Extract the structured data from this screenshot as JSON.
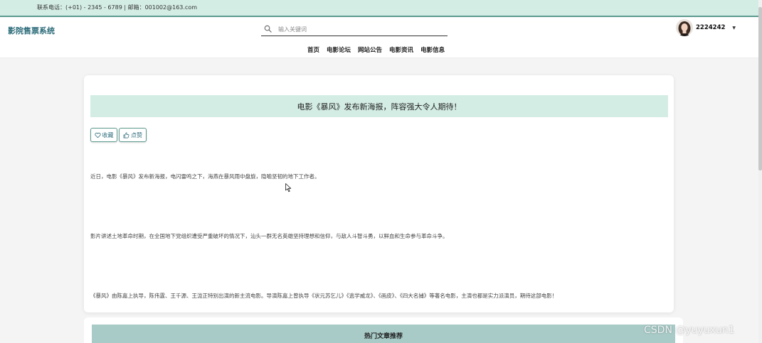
{
  "topbar": {
    "contact": "联系电话：(+01) - 2345 - 6789 | 邮箱：001002@163.com"
  },
  "header": {
    "brand": "影院售票系统",
    "search_placeholder": "输入关键词",
    "nav": [
      {
        "label": "首页"
      },
      {
        "label": "电影论坛"
      },
      {
        "label": "网站公告"
      },
      {
        "label": "电影资讯"
      },
      {
        "label": "电影信息"
      }
    ],
    "user": {
      "name": "2224242"
    }
  },
  "article": {
    "title": "电影《暴风》发布新海报，阵容强大令人期待！",
    "favorite_label": "收藏",
    "like_label": "点赞",
    "paragraphs": [
      "近日，电影《暴风》发布新海报，电闪雷鸣之下，海燕在暴风雨中盘旋，隐喻坚韧的地下工作者。",
      "影片讲述土地革命时期，在全国地下党组织遭受严重破坏的情况下，汕头一群无名英雄坚持理想和信仰，与敌人斗智斗勇，以鲜血和生命参与革命斗争。",
      "《暴风》由陈嘉上执导，陈伟霆、王千源、王泷正特别出演的新主流电影。导演陈嘉上曾执导《状元苏乞儿》《逃学威龙》、《画皮》、《四大名捕》等著名电影，主演也都是实力派演员，期待这部电影！"
    ]
  },
  "hot": {
    "title": "热门文章推荐"
  },
  "watermark": "CSDN @yuyuxun1",
  "colors": {
    "topbar_bg": "#d4ede4",
    "accent": "#5c9a8e",
    "brand_text": "#2a6a78",
    "hot_band": "#a8cbc8"
  }
}
